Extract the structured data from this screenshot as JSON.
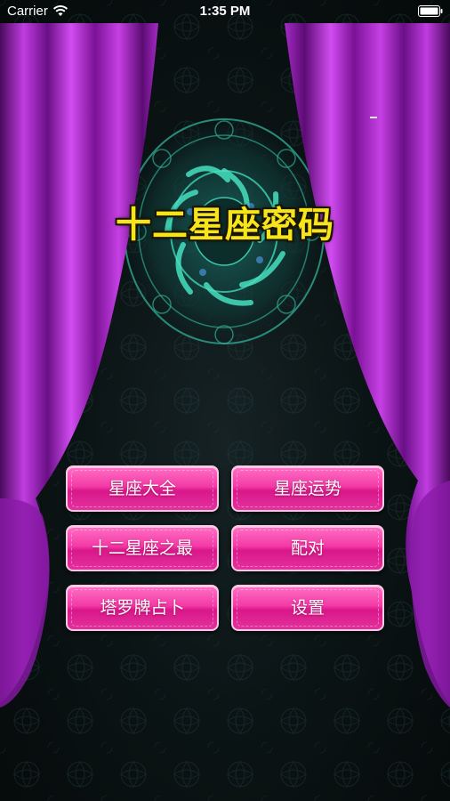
{
  "status_bar": {
    "carrier": "Carrier",
    "time": "1:35 PM",
    "wifi_icon": "wifi-icon",
    "battery_icon": "battery-icon"
  },
  "app": {
    "title": "十二星座密码",
    "emblem_icon": "zodiac-wheel-icon"
  },
  "menu": {
    "items": [
      {
        "label": "星座大全"
      },
      {
        "label": "星座运势"
      },
      {
        "label": "十二星座之最"
      },
      {
        "label": "配对"
      },
      {
        "label": "塔罗牌占卜"
      },
      {
        "label": "设置"
      }
    ]
  },
  "colors": {
    "curtain": "#a020c8",
    "title": "#f7e51b",
    "button": "#f33aa6",
    "emblem": "#3fd6b8"
  }
}
